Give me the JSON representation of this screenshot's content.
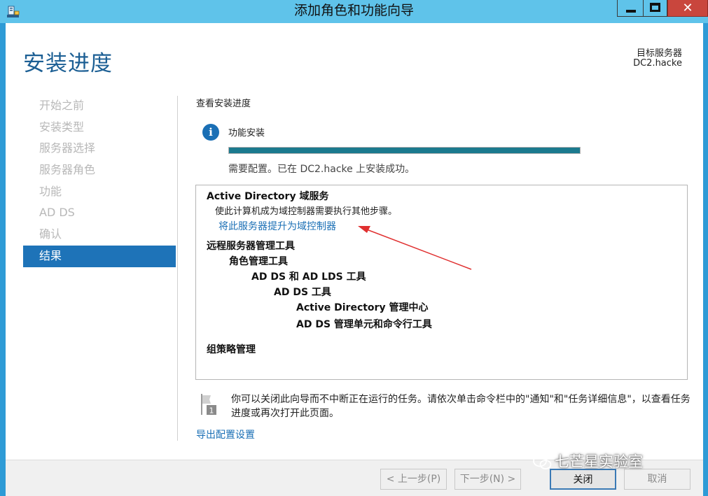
{
  "window": {
    "title": "添加角色和功能向导",
    "close_symbol": "✕"
  },
  "page": {
    "title": "安装进度",
    "target_server_label": "目标服务器",
    "target_server_value": "DC2.hacke"
  },
  "nav": {
    "items": [
      {
        "label": "开始之前",
        "active": false
      },
      {
        "label": "安装类型",
        "active": false
      },
      {
        "label": "服务器选择",
        "active": false
      },
      {
        "label": "服务器角色",
        "active": false
      },
      {
        "label": "功能",
        "active": false
      },
      {
        "label": "AD DS",
        "active": false
      },
      {
        "label": "确认",
        "active": false
      },
      {
        "label": "结果",
        "active": true
      }
    ]
  },
  "main": {
    "heading": "查看安装进度",
    "info_icon_glyph": "i",
    "feature_label": "功能安装",
    "progress_percent": 100,
    "status": "需要配置。已在 DC2.hacke 上安装成功。",
    "results": {
      "ad_ds_title": "Active Directory 域服务",
      "ad_ds_desc": "使此计算机成为域控制器需要执行其他步骤。",
      "promote_link": "将此服务器提升为域控制器",
      "rsat": "远程服务器管理工具",
      "role_tools": "角色管理工具",
      "ad_ds_lds_tools": "AD DS 和 AD LDS 工具",
      "ad_ds_tools": "AD DS 工具",
      "ad_admin_center": "Active Directory 管理中心",
      "ad_ds_snapins": "AD DS 管理单元和命令行工具",
      "gpm": "组策略管理"
    },
    "note_badge": "1",
    "note": "你可以关闭此向导而不中断正在运行的任务。请依次单击命令栏中的\"通知\"和\"任务详细信息\"，以查看任务进度或再次打开此页面。",
    "export_link": "导出配置设置"
  },
  "footer": {
    "prev_label": "< 上一步(P)",
    "next_label": "下一步(N) >",
    "close_label": "关闭",
    "cancel_label": "取消"
  },
  "watermark": "七芒星实验室",
  "colors": {
    "title_bar": "#5fc3ea",
    "accent": "#1e73b8",
    "progress_fill": "#1b7a8e",
    "link": "#1a6fb5",
    "arrow": "#e03030"
  }
}
